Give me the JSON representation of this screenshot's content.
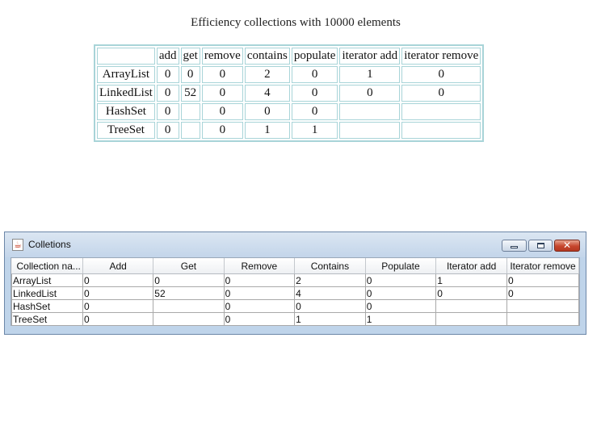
{
  "html_view": {
    "title": "Efficiency collections with 10000 elements",
    "headers": [
      "",
      "add",
      "get",
      "remove",
      "contains",
      "populate",
      "iterator add",
      "iterator remove"
    ],
    "rows": [
      [
        "ArrayList",
        "0",
        "0",
        "0",
        "2",
        "0",
        "1",
        "0"
      ],
      [
        "LinkedList",
        "0",
        "52",
        "0",
        "4",
        "0",
        "0",
        "0"
      ],
      [
        "HashSet",
        "0",
        "",
        "0",
        "0",
        "0",
        "",
        ""
      ],
      [
        "TreeSet",
        "0",
        "",
        "0",
        "1",
        "1",
        "",
        ""
      ]
    ]
  },
  "window": {
    "title": "Colletions",
    "app_icon": "java-icon",
    "controls": [
      "minimize-icon",
      "maximize-icon",
      "close-icon"
    ],
    "close_glyph": "✕",
    "table": {
      "headers": [
        "Collection na...",
        "Add",
        "Get",
        "Remove",
        "Contains",
        "Populate",
        "Iterator add",
        "Iterator remove"
      ],
      "rows": [
        [
          "ArrayList",
          "0",
          "0",
          "0",
          "2",
          "0",
          "1",
          "0"
        ],
        [
          "LinkedList",
          "0",
          "52",
          "0",
          "4",
          "0",
          "0",
          "0"
        ],
        [
          "HashSet",
          "0",
          "",
          "0",
          "0",
          "0",
          "",
          ""
        ],
        [
          "TreeSet",
          "0",
          "",
          "0",
          "1",
          "1",
          "",
          ""
        ]
      ]
    }
  },
  "colors": {
    "html_table_border": "#a8d4d8",
    "window_frame": "#bfd4ea",
    "close_button": "#c6462d"
  }
}
